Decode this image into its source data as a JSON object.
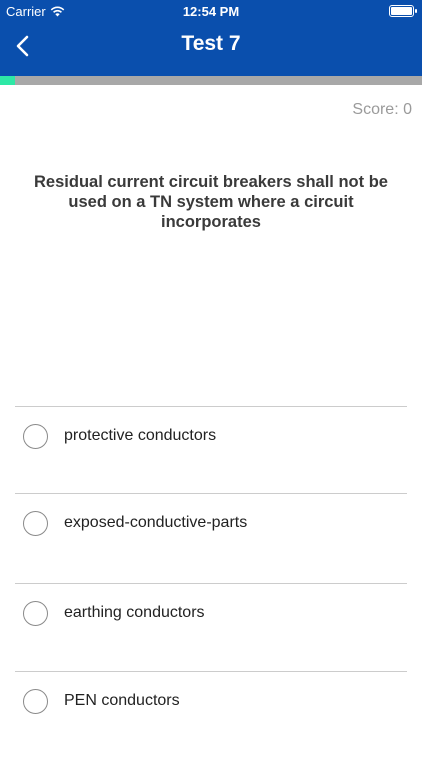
{
  "status_bar": {
    "carrier": "Carrier",
    "time": "12:54 PM"
  },
  "nav": {
    "title": "Test 7",
    "back_icon": "chevron-left-icon"
  },
  "progress": {
    "fraction": 0.035,
    "fill_color": "#2ee8a6",
    "track_color": "#a8a8a8"
  },
  "score": {
    "label": "Score: 0"
  },
  "question": {
    "text": "Residual current circuit breakers shall not be used on a TN system where a circuit incorporates"
  },
  "options": [
    {
      "label": "protective conductors"
    },
    {
      "label": "exposed-conductive-parts"
    },
    {
      "label": "earthing conductors"
    },
    {
      "label": "PEN conductors"
    }
  ],
  "colors": {
    "header": "#0a4fad"
  }
}
